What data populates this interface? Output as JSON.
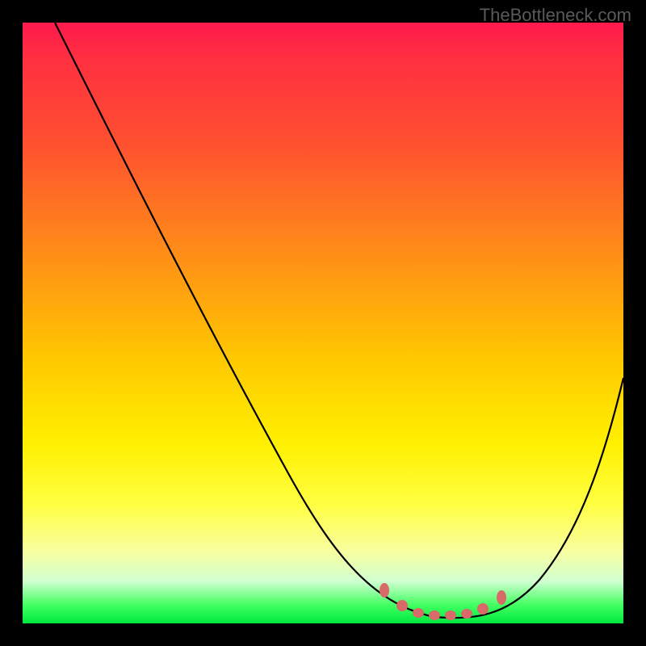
{
  "watermark": {
    "text": "TheBottleneck.com"
  },
  "chart_data": {
    "type": "line",
    "title": "",
    "xlabel": "",
    "ylabel": "",
    "xlim": [
      0,
      100
    ],
    "ylim": [
      0,
      100
    ],
    "series": [
      {
        "name": "bottleneck-curve",
        "x": [
          0,
          10,
          20,
          30,
          40,
          50,
          60,
          65,
          70,
          75,
          80,
          85,
          90,
          95,
          100
        ],
        "values": [
          100,
          85,
          70,
          55,
          40,
          25,
          10,
          4,
          1,
          0,
          1,
          4,
          15,
          28,
          42
        ]
      }
    ],
    "markers": {
      "name": "highlight-segment",
      "color": "#d96a6a",
      "points_x": [
        62,
        65,
        68,
        71,
        74,
        77,
        80,
        83
      ],
      "points_y": [
        5,
        3,
        2,
        1,
        1,
        2,
        3,
        5
      ]
    }
  }
}
